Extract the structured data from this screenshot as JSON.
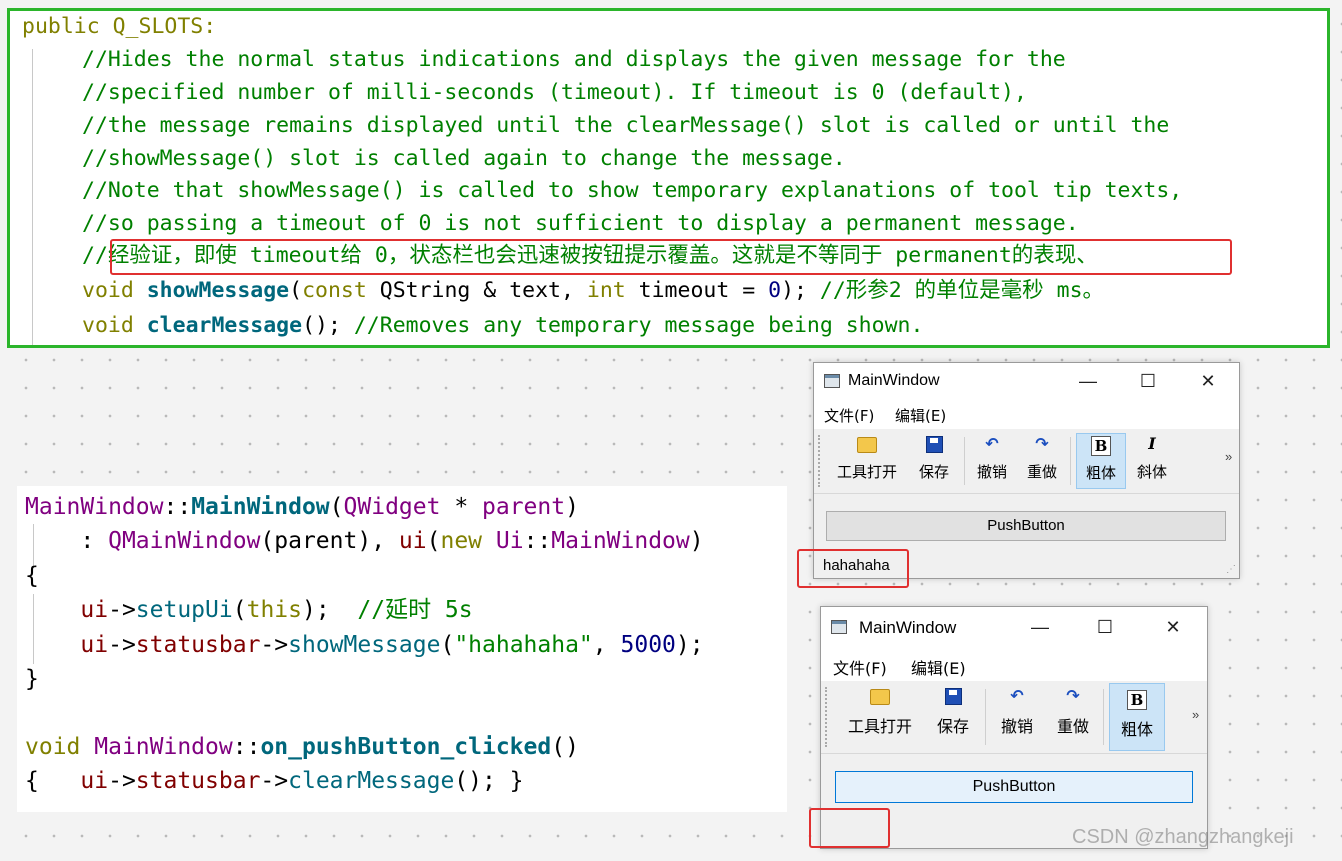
{
  "top_code": {
    "l1": "public Q_SLOTS:",
    "l2": "//Hides the normal status indications and displays the given message for the",
    "l3": "//specified number of milli-seconds (timeout). If timeout is 0 (default),",
    "l4": "//the message remains displayed until the clearMessage() slot is called or until the",
    "l5": "//showMessage() slot is called again to change the message.",
    "l6": "//Note that showMessage() is called to show temporary explanations of tool tip texts,",
    "l7": "//so passing a timeout of 0 is not sufficient to display a permanent message.",
    "l8": "//经验证，即使 timeout给 0，状态栏也会迅速被按钮提示覆盖。这就是不等同于 permanent的表现、",
    "l9_void": "void",
    "l9_fn": "showMessage",
    "l9_a": "(",
    "l9_const": "const",
    "l9_b": " QString & text, ",
    "l9_int": "int",
    "l9_c": " timeout = ",
    "l9_zero": "0",
    "l9_d": "); ",
    "l9_cm": "//形参2 的单位是毫秒 ms。",
    "l10_void": "void",
    "l10_fn": "clearMessage",
    "l10_a": "(); ",
    "l10_cm": "//Removes any temporary message being shown."
  },
  "bottom_code": {
    "l1_a": "MainWindow",
    "l1_b": "::",
    "l1_c": "MainWindow",
    "l1_d": "(",
    "l1_e": "QWidget",
    "l1_f": " * ",
    "l1_g": "parent",
    "l1_h": ")",
    "l2_a": "    : ",
    "l2_b": "QMainWindow",
    "l2_c": "(parent), ",
    "l2_d": "ui",
    "l2_e": "(",
    "l2_f": "new",
    "l2_g": " ",
    "l2_h": "Ui",
    "l2_i": "::",
    "l2_j": "MainWindow",
    "l2_k": ")",
    "l3": "{",
    "l4_a": "    ui",
    "l4_b": "->",
    "l4_c": "setupUi",
    "l4_d": "(",
    "l4_e": "this",
    "l4_f": ");  ",
    "l4_g": "//延时 5s",
    "l5_a": "    ui",
    "l5_b": "->",
    "l5_c": "statusbar",
    "l5_d": "->",
    "l5_e": "showMessage",
    "l5_f": "(",
    "l5_g": "\"hahahaha\"",
    "l5_h": ", ",
    "l5_i": "5000",
    "l5_j": ");",
    "l6": "}",
    "l8_a": "void",
    "l8_b": " ",
    "l8_c": "MainWindow",
    "l8_d": "::",
    "l8_e": "on_pushButton_clicked",
    "l8_f": "()",
    "l9_a": "{   ",
    "l9_b": "ui",
    "l9_c": "->",
    "l9_d": "statusbar",
    "l9_e": "->",
    "l9_f": "clearMessage",
    "l9_g": "(); }"
  },
  "window1": {
    "title": "MainWindow",
    "minimize": "—",
    "maximize": "☐",
    "close": "✕",
    "menus": [
      "文件(F)",
      "编辑(E)"
    ],
    "toolbar": [
      "工具打开",
      "保存",
      "撤销",
      "重做",
      "粗体",
      "斜体"
    ],
    "more": "»",
    "push_button": "PushButton",
    "status_message": "hahahaha"
  },
  "window2": {
    "title": "MainWindow",
    "minimize": "—",
    "maximize": "☐",
    "close": "✕",
    "menus": [
      "文件(F)",
      "编辑(E)"
    ],
    "toolbar": [
      "工具打开",
      "保存",
      "撤销",
      "重做",
      "粗体"
    ],
    "more": "»",
    "push_button": "PushButton",
    "status_message": ""
  },
  "icons": {
    "open": "folder-icon",
    "save": "floppy-icon",
    "undo": "↶",
    "redo": "↷",
    "bold": "B",
    "italic": "I"
  },
  "watermark": "CSDN @zhangzhangkeji",
  "colors": {
    "highlight_border": "#2bb52b",
    "annotation_red": "#e03030",
    "comment": "#008000",
    "keyword": "#808000",
    "function": "#00677c"
  }
}
